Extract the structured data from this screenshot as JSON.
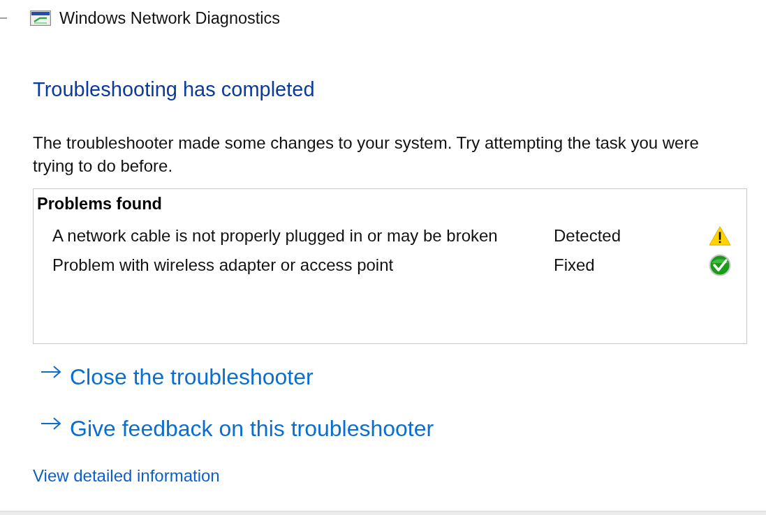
{
  "window": {
    "title": "Windows Network Diagnostics"
  },
  "heading": "Troubleshooting has completed",
  "description": "The troubleshooter made some changes to your system. Try attempting the task you were trying to do before.",
  "problems": {
    "title": "Problems found",
    "items": [
      {
        "text": "A network cable is not properly plugged in or may be broken",
        "status": "Detected",
        "kind": "warning"
      },
      {
        "text": "Problem with wireless adapter or access point",
        "status": "Fixed",
        "kind": "fixed"
      }
    ]
  },
  "actions": [
    {
      "label": "Close the troubleshooter"
    },
    {
      "label": "Give feedback on this troubleshooter"
    }
  ],
  "details_link": "View detailed information"
}
